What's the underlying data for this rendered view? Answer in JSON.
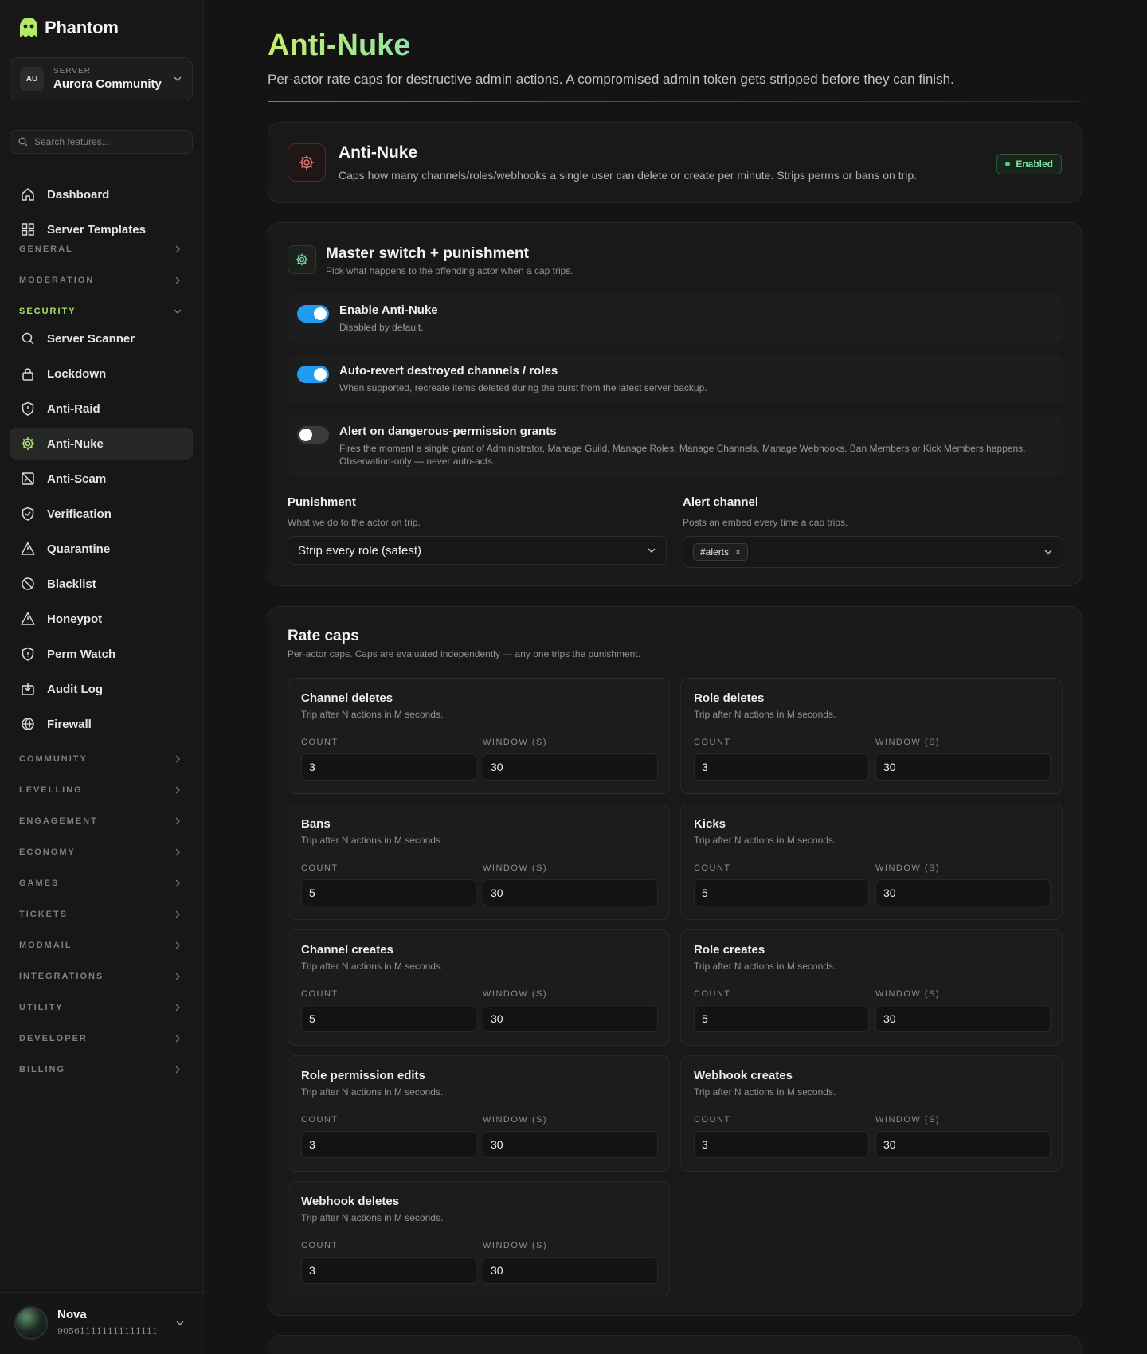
{
  "brand": {
    "name": "Phantom"
  },
  "server": {
    "label": "SERVER",
    "initials": "AU",
    "name": "Aurora Community"
  },
  "search": {
    "placeholder": "Search features..."
  },
  "nav_top": [
    {
      "label": "Dashboard",
      "icon": "home-icon"
    },
    {
      "label": "Server Templates",
      "icon": "grid-icon"
    }
  ],
  "groups_before": [
    {
      "label": "GENERAL"
    },
    {
      "label": "MODERATION"
    }
  ],
  "security_group": {
    "label": "SECURITY"
  },
  "security_items": [
    {
      "label": "Server Scanner",
      "icon": "search-icon"
    },
    {
      "label": "Lockdown",
      "icon": "lock-icon"
    },
    {
      "label": "Anti-Raid",
      "icon": "shield-icon"
    },
    {
      "label": "Anti-Nuke",
      "icon": "gear-icon",
      "active": true
    },
    {
      "label": "Anti-Scam",
      "icon": "image-off-icon"
    },
    {
      "label": "Verification",
      "icon": "shield-check-icon"
    },
    {
      "label": "Quarantine",
      "icon": "warning-icon"
    },
    {
      "label": "Blacklist",
      "icon": "ban-icon"
    },
    {
      "label": "Honeypot",
      "icon": "warning-icon"
    },
    {
      "label": "Perm Watch",
      "icon": "shield-icon"
    },
    {
      "label": "Audit Log",
      "icon": "download-box-icon"
    },
    {
      "label": "Firewall",
      "icon": "globe-icon"
    }
  ],
  "groups_after": [
    {
      "label": "COMMUNITY"
    },
    {
      "label": "LEVELLING"
    },
    {
      "label": "ENGAGEMENT"
    },
    {
      "label": "ECONOMY"
    },
    {
      "label": "GAMES"
    },
    {
      "label": "TICKETS"
    },
    {
      "label": "MODMAIL"
    },
    {
      "label": "INTEGRATIONS"
    },
    {
      "label": "UTILITY"
    },
    {
      "label": "DEVELOPER"
    },
    {
      "label": "BILLING"
    }
  ],
  "user": {
    "name": "Nova",
    "id": "905611111111111111"
  },
  "page": {
    "title": "Anti-Nuke",
    "subtitle": "Per-actor rate caps for destructive admin actions. A compromised admin token gets stripped before they can finish."
  },
  "feature": {
    "title": "Anti-Nuke",
    "description": "Caps how many channels/roles/webhooks a single user can delete or create per minute. Strips perms or bans on trip.",
    "status": "Enabled"
  },
  "master": {
    "title": "Master switch + punishment",
    "description": "Pick what happens to the offending actor when a cap trips.",
    "toggles": [
      {
        "title": "Enable Anti-Nuke",
        "description": "Disabled by default.",
        "on": true
      },
      {
        "title": "Auto-revert destroyed channels / roles",
        "description": "When supported, recreate items deleted during the burst from the latest server backup.",
        "on": true
      },
      {
        "title": "Alert on dangerous-permission grants",
        "description": "Fires the moment a single grant of Administrator, Manage Guild, Manage Roles, Manage Channels, Manage Webhooks, Ban Members or Kick Members happens. Observation-only — never auto-acts.",
        "on": false
      }
    ],
    "punishment": {
      "label": "Punishment",
      "help": "What we do to the actor on trip.",
      "value": "Strip every role (safest)"
    },
    "alert_channel": {
      "label": "Alert channel",
      "help": "Posts an embed every time a cap trips.",
      "chip": "#alerts",
      "chip_remove": "×"
    }
  },
  "caps": {
    "title": "Rate caps",
    "description": "Per-actor caps. Caps are evaluated independently — any one trips the punishment.",
    "count_label": "COUNT",
    "window_label": "WINDOW (S)",
    "items": [
      {
        "title": "Channel deletes",
        "description": "Trip after N actions in M seconds.",
        "count": "3",
        "window": "30"
      },
      {
        "title": "Role deletes",
        "description": "Trip after N actions in M seconds.",
        "count": "3",
        "window": "30"
      },
      {
        "title": "Bans",
        "description": "Trip after N actions in M seconds.",
        "count": "5",
        "window": "30"
      },
      {
        "title": "Kicks",
        "description": "Trip after N actions in M seconds.",
        "count": "5",
        "window": "30"
      },
      {
        "title": "Channel creates",
        "description": "Trip after N actions in M seconds.",
        "count": "5",
        "window": "30"
      },
      {
        "title": "Role creates",
        "description": "Trip after N actions in M seconds.",
        "count": "5",
        "window": "30"
      },
      {
        "title": "Role permission edits",
        "description": "Trip after N actions in M seconds.",
        "count": "3",
        "window": "30"
      },
      {
        "title": "Webhook creates",
        "description": "Trip after N actions in M seconds.",
        "count": "3",
        "window": "30"
      },
      {
        "title": "Webhook deletes",
        "description": "Trip after N actions in M seconds.",
        "count": "3",
        "window": "30"
      }
    ]
  }
}
